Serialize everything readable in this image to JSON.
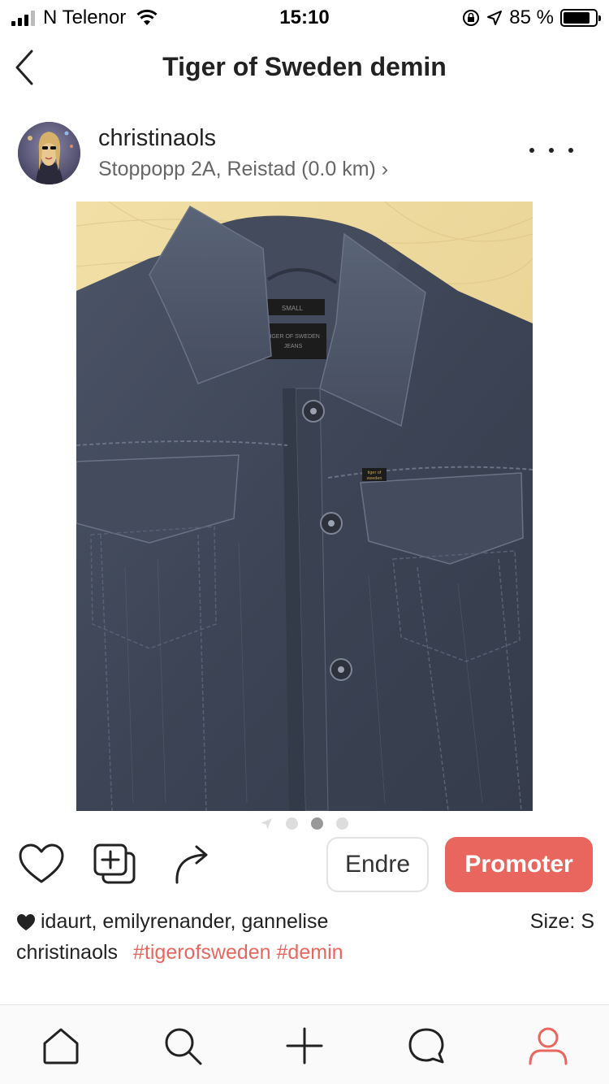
{
  "status_bar": {
    "carrier": "N Telenor",
    "time": "15:10",
    "battery": "85 %",
    "battery_level": 0.85,
    "signal_bars": 3
  },
  "nav": {
    "title": "Tiger of Sweden demin",
    "back_icon": "chevron-left-icon"
  },
  "post": {
    "username": "christinaols",
    "location": "Stoppopp 2A, Reistad (0.0 km) ›",
    "image": {
      "label_small": "SMALL",
      "label_brand_1": "TIGER OF SWEDEN",
      "label_brand_2": "JEANS",
      "tag_1": "tiger of",
      "tag_2": "sweden"
    },
    "carousel": {
      "count": 3,
      "active_index": 1
    }
  },
  "actions": {
    "edit_label": "Endre",
    "promote_label": "Promoter",
    "accent_color": "#e8665e"
  },
  "likes": {
    "text": "idaurt, emilyrenander, gannelise"
  },
  "size": "Size: S",
  "caption": {
    "user": "christinaols",
    "tags": [
      "#tigerofsweden",
      "#demin"
    ]
  },
  "tabbar": {
    "items": [
      "home-icon",
      "search-icon",
      "add-icon",
      "chat-icon",
      "profile-icon"
    ],
    "active": "profile-icon"
  }
}
